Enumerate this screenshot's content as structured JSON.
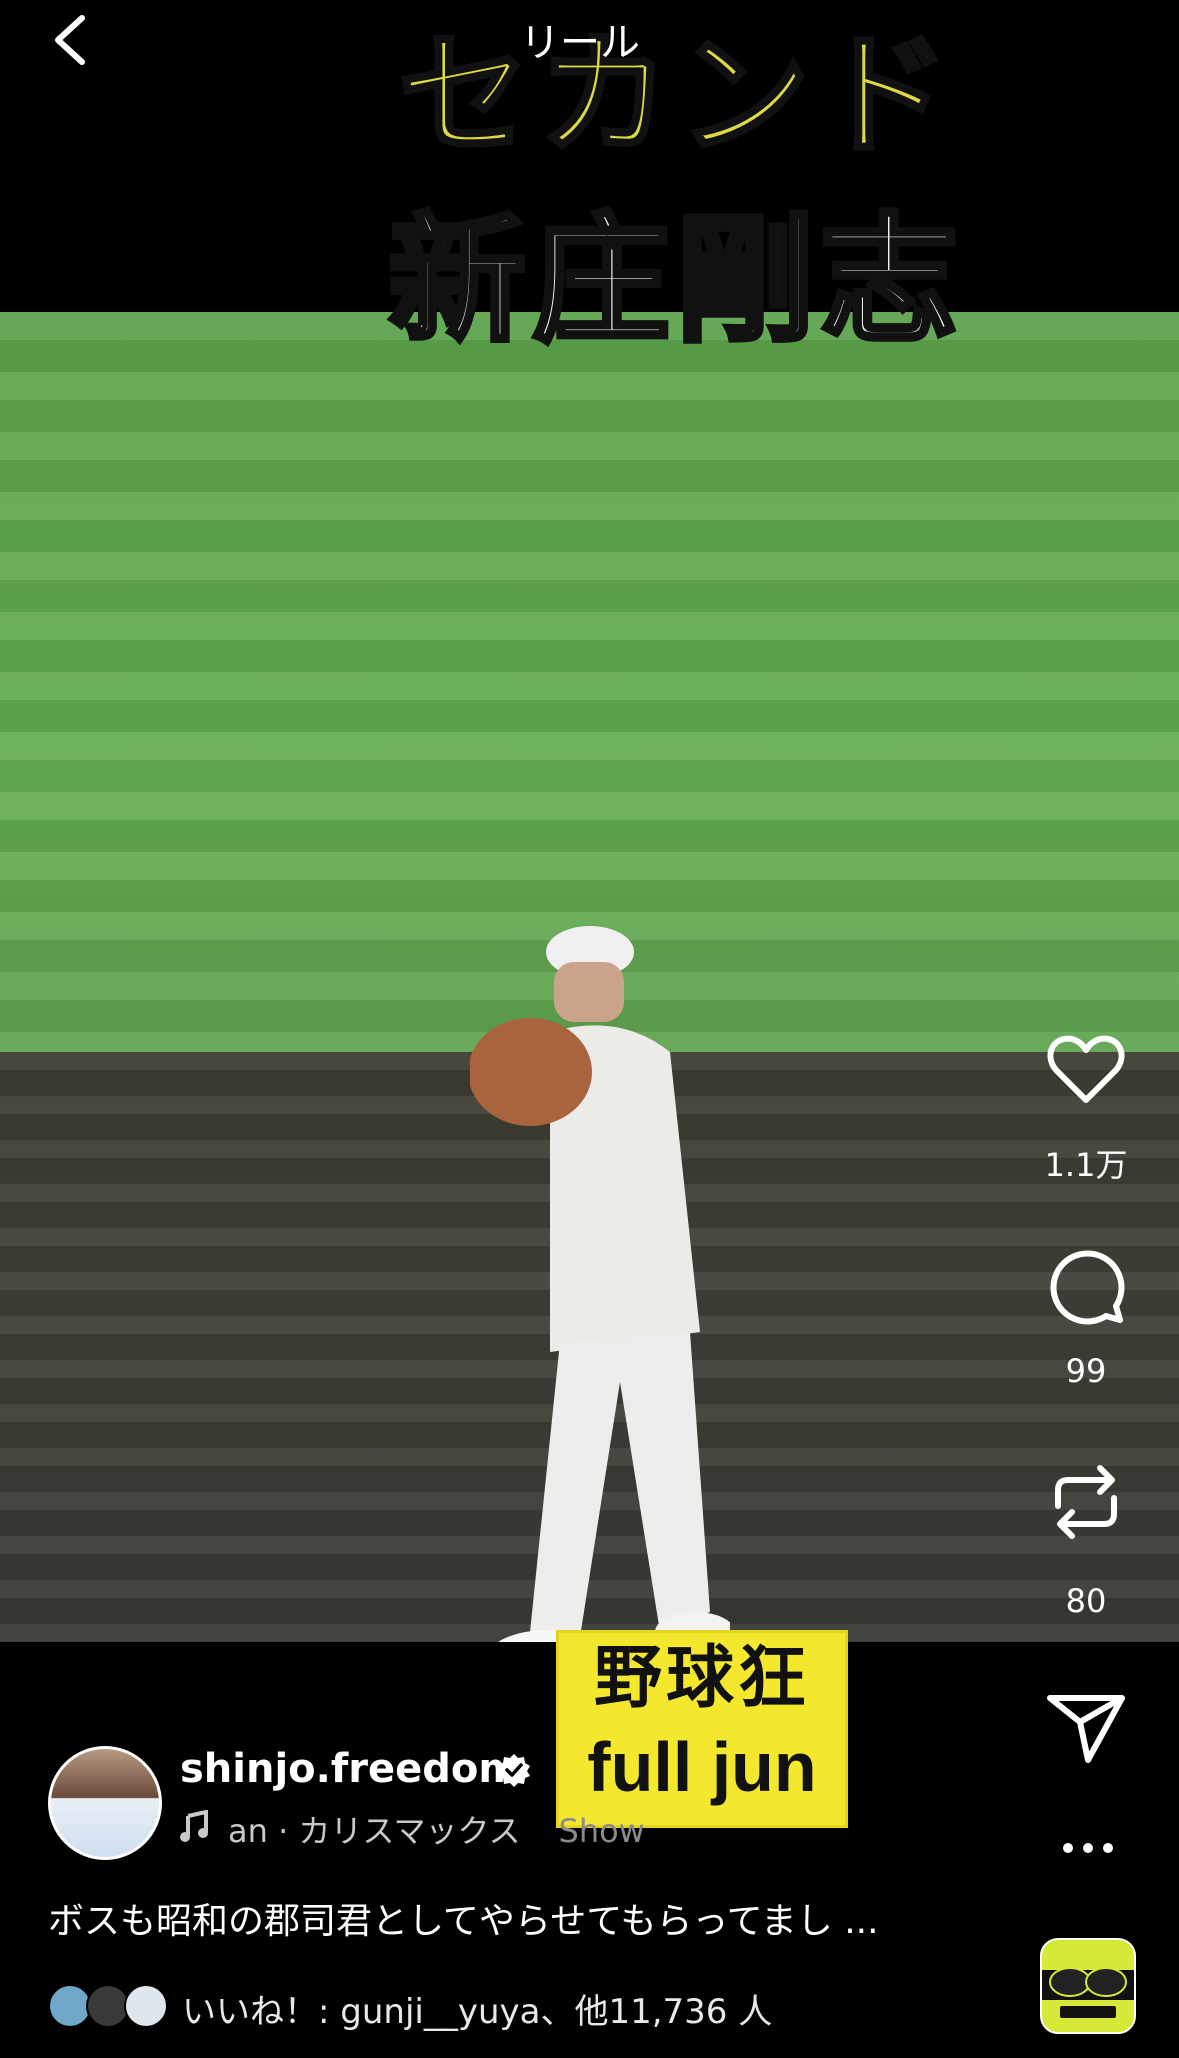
{
  "header": {
    "title": "リール",
    "back_icon": "chevron-left-icon"
  },
  "video": {
    "caption_top": "セカンド",
    "caption_name": "新庄剛志",
    "badge_line1": "野球狂",
    "badge_line2": "full jun"
  },
  "actions": {
    "like_count": "1.1万",
    "comment_count": "99",
    "repost_count": "80"
  },
  "post": {
    "username": "shinjo.freedom",
    "music_text": "an · カリスマックス",
    "music_fade": "Show",
    "caption": "ボスも昭和の郡司君としてやらせてもらってまし ...",
    "likes_text": "いいね！: gunji__yuya、他11,736 人"
  },
  "colors": {
    "caption_yellow": "#dcd945",
    "badge_yellow": "#f3e82d",
    "album_yellow": "#d6e938"
  }
}
